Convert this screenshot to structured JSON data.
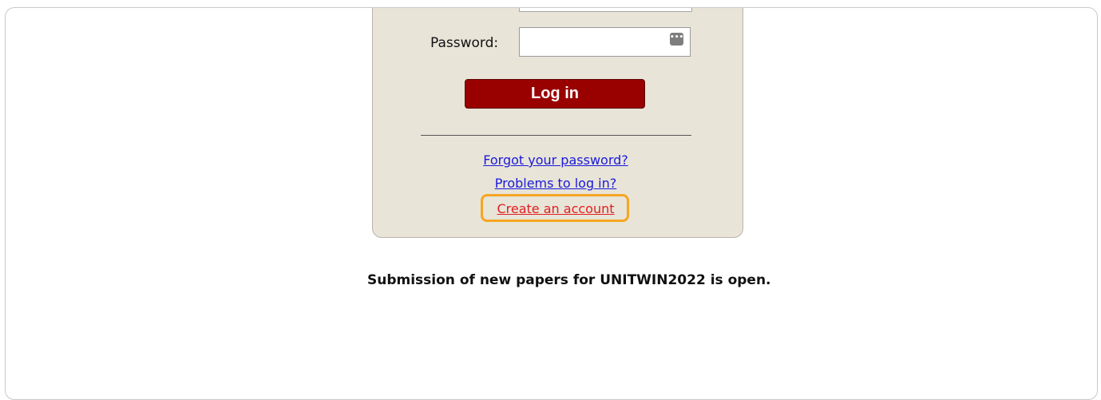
{
  "login": {
    "password_label": "Password:",
    "password_value": "",
    "password_reveal_glyph": "•••",
    "login_button_label": "Log in",
    "forgot_link": "Forgot your password?",
    "problems_link": "Problems to log in?",
    "create_account_link": "Create an account"
  },
  "notice": {
    "text": "Submission of new papers for UNITWIN2022 is open."
  },
  "colors": {
    "panel_background": "#e8e4d8",
    "login_button": "#990000",
    "link": "#1a1adb",
    "create_link": "#e02020",
    "highlight": "#f5a623"
  }
}
